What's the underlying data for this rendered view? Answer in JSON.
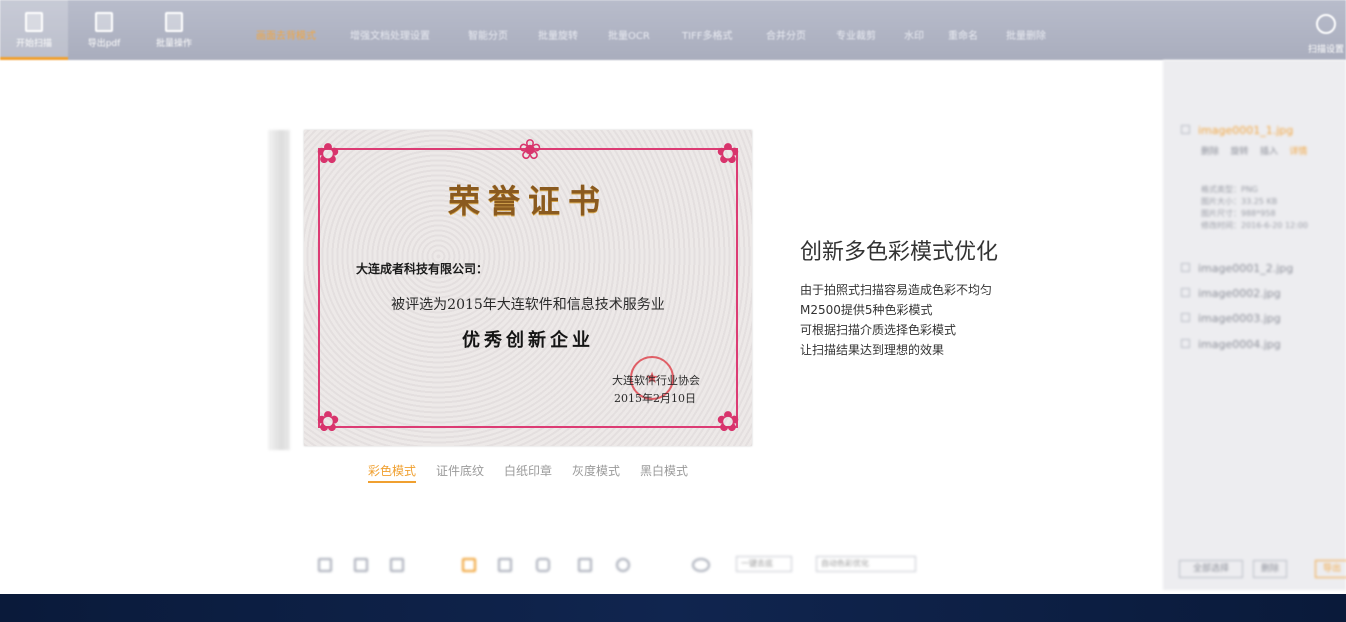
{
  "toolbar": {
    "tools": [
      {
        "label": "开始扫描",
        "icon": "scan-icon",
        "active": true
      },
      {
        "label": "导出pdf",
        "icon": "pdf-icon",
        "active": false
      },
      {
        "label": "批量操作",
        "icon": "batch-icon",
        "active": false
      }
    ],
    "menu": [
      "画面去背模式",
      "增强文档处理设置",
      "智能分页",
      "批量旋转",
      "批量OCR",
      "TIFF多格式",
      "合并分页",
      "专业裁剪",
      "水印",
      "重命名",
      "批量删除"
    ],
    "settings_label": "扫描设置",
    "accent": "#f0a030"
  },
  "certificate": {
    "title": "荣誉证书",
    "company": "大连成者科技有限公司：",
    "line": "被评选为2015年大连软件和信息技术服务业",
    "award": "优秀创新企业",
    "issuer": "大连软件行业协会",
    "date": "2015年2月10日"
  },
  "mode_tabs": [
    {
      "label": "彩色模式",
      "active": true
    },
    {
      "label": "证件底纹",
      "active": false
    },
    {
      "label": "白纸印章",
      "active": false
    },
    {
      "label": "灰度模式",
      "active": false
    },
    {
      "label": "黑白模式",
      "active": false
    }
  ],
  "feature": {
    "title": "创新多色彩模式优化",
    "lines": [
      "由于拍照式扫描容易造成色彩不均匀",
      "M2500提供5种色彩模式",
      "可根据扫描介质选择色彩模式",
      "让扫描结果达到理想的效果"
    ]
  },
  "bottom": {
    "select1": "一键去底",
    "select2": "自动色彩优化"
  },
  "right_panel": {
    "files": [
      "image0001_1.jpg",
      "image0001_2.jpg",
      "image0002.jpg",
      "image0003.jpg",
      "image0004.jpg"
    ],
    "file_actions": [
      "删除",
      "旋转",
      "插入",
      "详情"
    ],
    "meta": [
      "格式类型：PNG",
      "图片大小：33.25 KB",
      "图片尺寸：988*958",
      "修改时间：2016-6-20 12:00"
    ],
    "buttons": [
      "全部选择",
      "删除",
      "导出"
    ]
  },
  "colors": {
    "taskbar": "#0f2249",
    "panel": "#ededf0"
  }
}
